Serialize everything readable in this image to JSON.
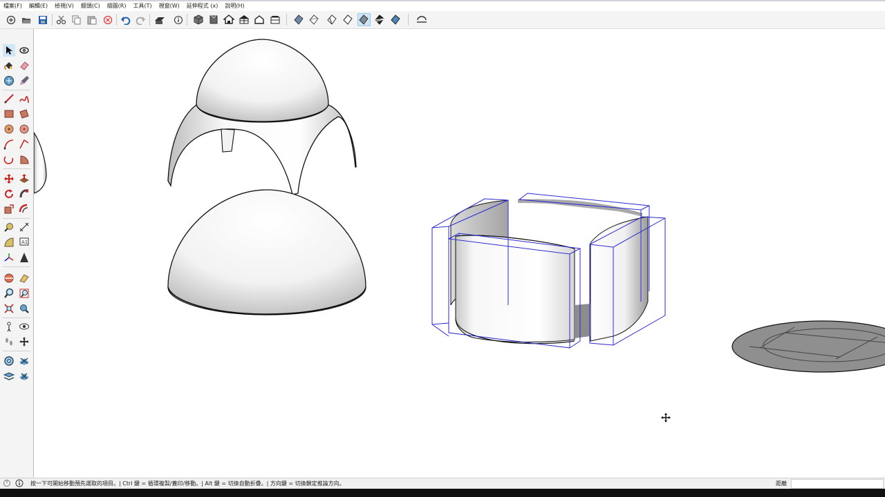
{
  "menu": [
    "檔案(F)",
    "編輯(E)",
    "檢視(V)",
    "鏡頭(C)",
    "繪圖(R)",
    "工具(T)",
    "視窗(W)",
    "延伸程式 (x)",
    "說明(H)"
  ],
  "status": {
    "hint": "按一下可開始移動預先選取的項目。| Ctrl 鍵 = 循環複製/蓋印/移動。| Alt 鍵 = 切換自動折疊。| 方向鍵 = 切換鎖定推論方向。",
    "distance_label": "距離",
    "distance_value": ""
  },
  "colors": {
    "selection": "#2a2ad6",
    "toolbar_bg": "#f4f4f4",
    "active": "#cfe6f7"
  }
}
